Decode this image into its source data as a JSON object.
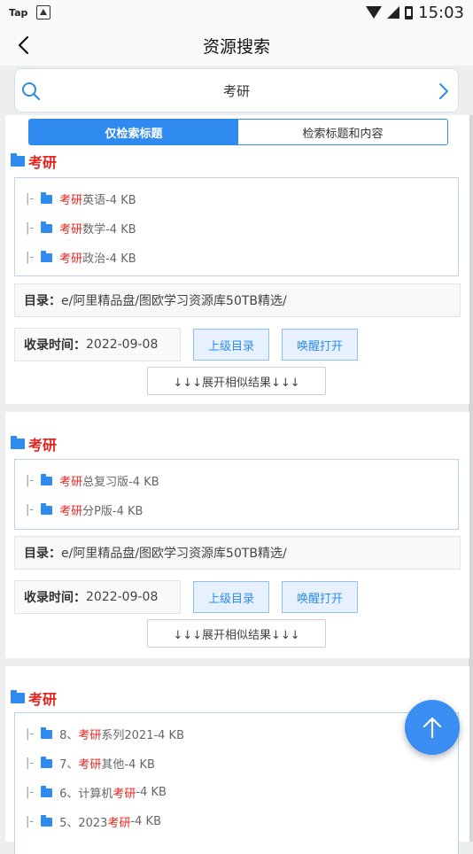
{
  "status": {
    "left_label": "Tap",
    "time": "15:03"
  },
  "header": {
    "title": "资源搜索"
  },
  "search": {
    "query": "考研"
  },
  "filter": {
    "option_title": "仅检索标题",
    "option_content": "检索标题和内容"
  },
  "labels": {
    "dir_label": "目录：",
    "time_label": "收录时间：",
    "parent_btn": "上级目录",
    "open_btn": "唤醒打开",
    "expand": "↓↓↓展开相似结果↓↓↓",
    "tree_mark": "|-"
  },
  "results": [
    {
      "title": "考研",
      "items": [
        {
          "pre": "",
          "hl": "考研",
          "post": "英语-4 KB"
        },
        {
          "pre": "",
          "hl": "考研",
          "post": "数学-4 KB"
        },
        {
          "pre": "",
          "hl": "考研",
          "post": "政治-4 KB"
        }
      ],
      "dir": "e/阿里精品盘/图欧学习资源库50TB精选/",
      "date": "2022-09-08"
    },
    {
      "title": "考研",
      "items": [
        {
          "pre": "",
          "hl": "考研",
          "post": "总复习版-4 KB"
        },
        {
          "pre": "",
          "hl": "考研",
          "post": "分P版-4 KB"
        }
      ],
      "dir": "e/阿里精品盘/图欧学习资源库50TB精选/",
      "date": "2022-09-08"
    },
    {
      "title": "考研",
      "items": [
        {
          "pre": "8、",
          "hl": "考研",
          "post": "系列2021-4 KB"
        },
        {
          "pre": "7、",
          "hl": "考研",
          "post": "其他-4 KB"
        },
        {
          "pre": "6、计算机",
          "hl": "考研",
          "post": "-4 KB"
        },
        {
          "pre": "5、2023",
          "hl": "考研",
          "post": "-4 KB"
        }
      ]
    }
  ]
}
